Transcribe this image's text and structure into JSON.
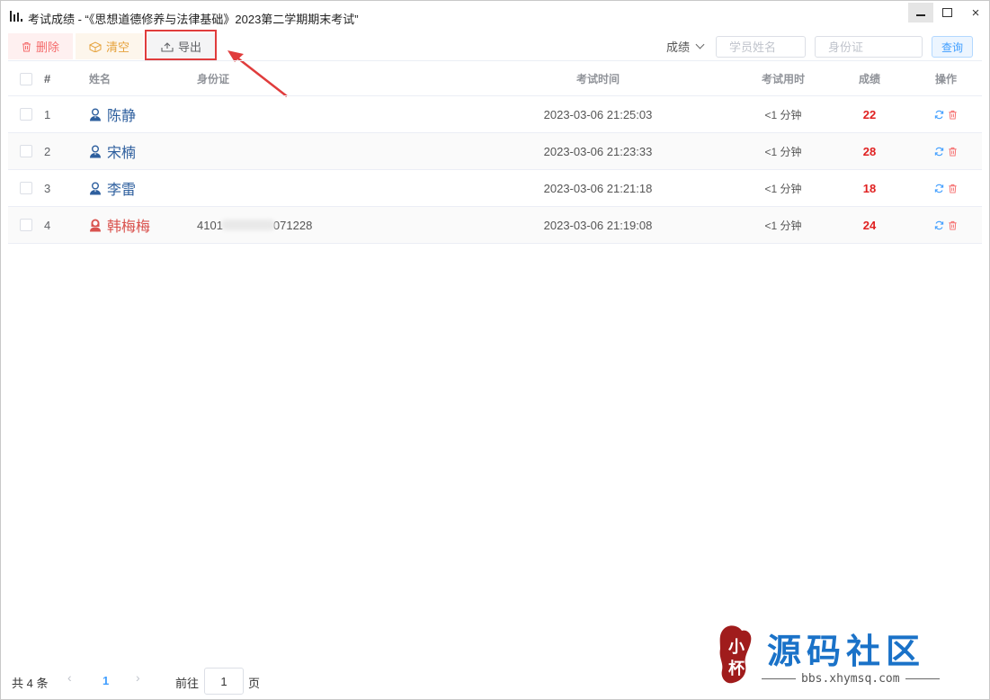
{
  "window": {
    "title": "考试成绩 - “《思想道德修养与法律基础》2023第二学期期末考试”"
  },
  "toolbar": {
    "delete_label": "删除",
    "clear_label": "清空",
    "export_label": "导出",
    "sort_label": "成绩",
    "name_placeholder": "学员姓名",
    "id_placeholder": "身份证",
    "query_label": "查询"
  },
  "table": {
    "headers": {
      "index": "#",
      "name": "姓名",
      "id_card": "身份证",
      "exam_time": "考试时间",
      "duration": "考试用时",
      "score": "成绩",
      "ops": "操作"
    },
    "rows": [
      {
        "index": "1",
        "name": "陈静",
        "gender": "male",
        "id_prefix": "",
        "id_suffix": "",
        "time": "2023-03-06 21:25:03",
        "duration": "<1 分钟",
        "score": "22"
      },
      {
        "index": "2",
        "name": "宋楠",
        "gender": "male",
        "id_prefix": "",
        "id_suffix": "",
        "time": "2023-03-06 21:23:33",
        "duration": "<1 分钟",
        "score": "28"
      },
      {
        "index": "3",
        "name": "李雷",
        "gender": "male",
        "id_prefix": "",
        "id_suffix": "",
        "time": "2023-03-06 21:21:18",
        "duration": "<1 分钟",
        "score": "18"
      },
      {
        "index": "4",
        "name": "韩梅梅",
        "gender": "female",
        "id_prefix": "4101",
        "id_suffix": "071228",
        "time": "2023-03-06 21:19:08",
        "duration": "<1 分钟",
        "score": "24"
      }
    ]
  },
  "pagination": {
    "total": "共 4 条",
    "current": "1",
    "goto_label": "前往",
    "goto_value": "1",
    "page_label": "页"
  },
  "watermark": {
    "title": "源码社区",
    "url": "bbs.xhymsq.com",
    "seal_text": "小杯"
  },
  "colors": {
    "danger": "#f56c6c",
    "warning": "#e6a23c",
    "primary": "#409eff",
    "score": "#e02020",
    "male_name": "#2e5f9e",
    "female_name": "#d9534f",
    "annotation": "#e03c3c"
  }
}
